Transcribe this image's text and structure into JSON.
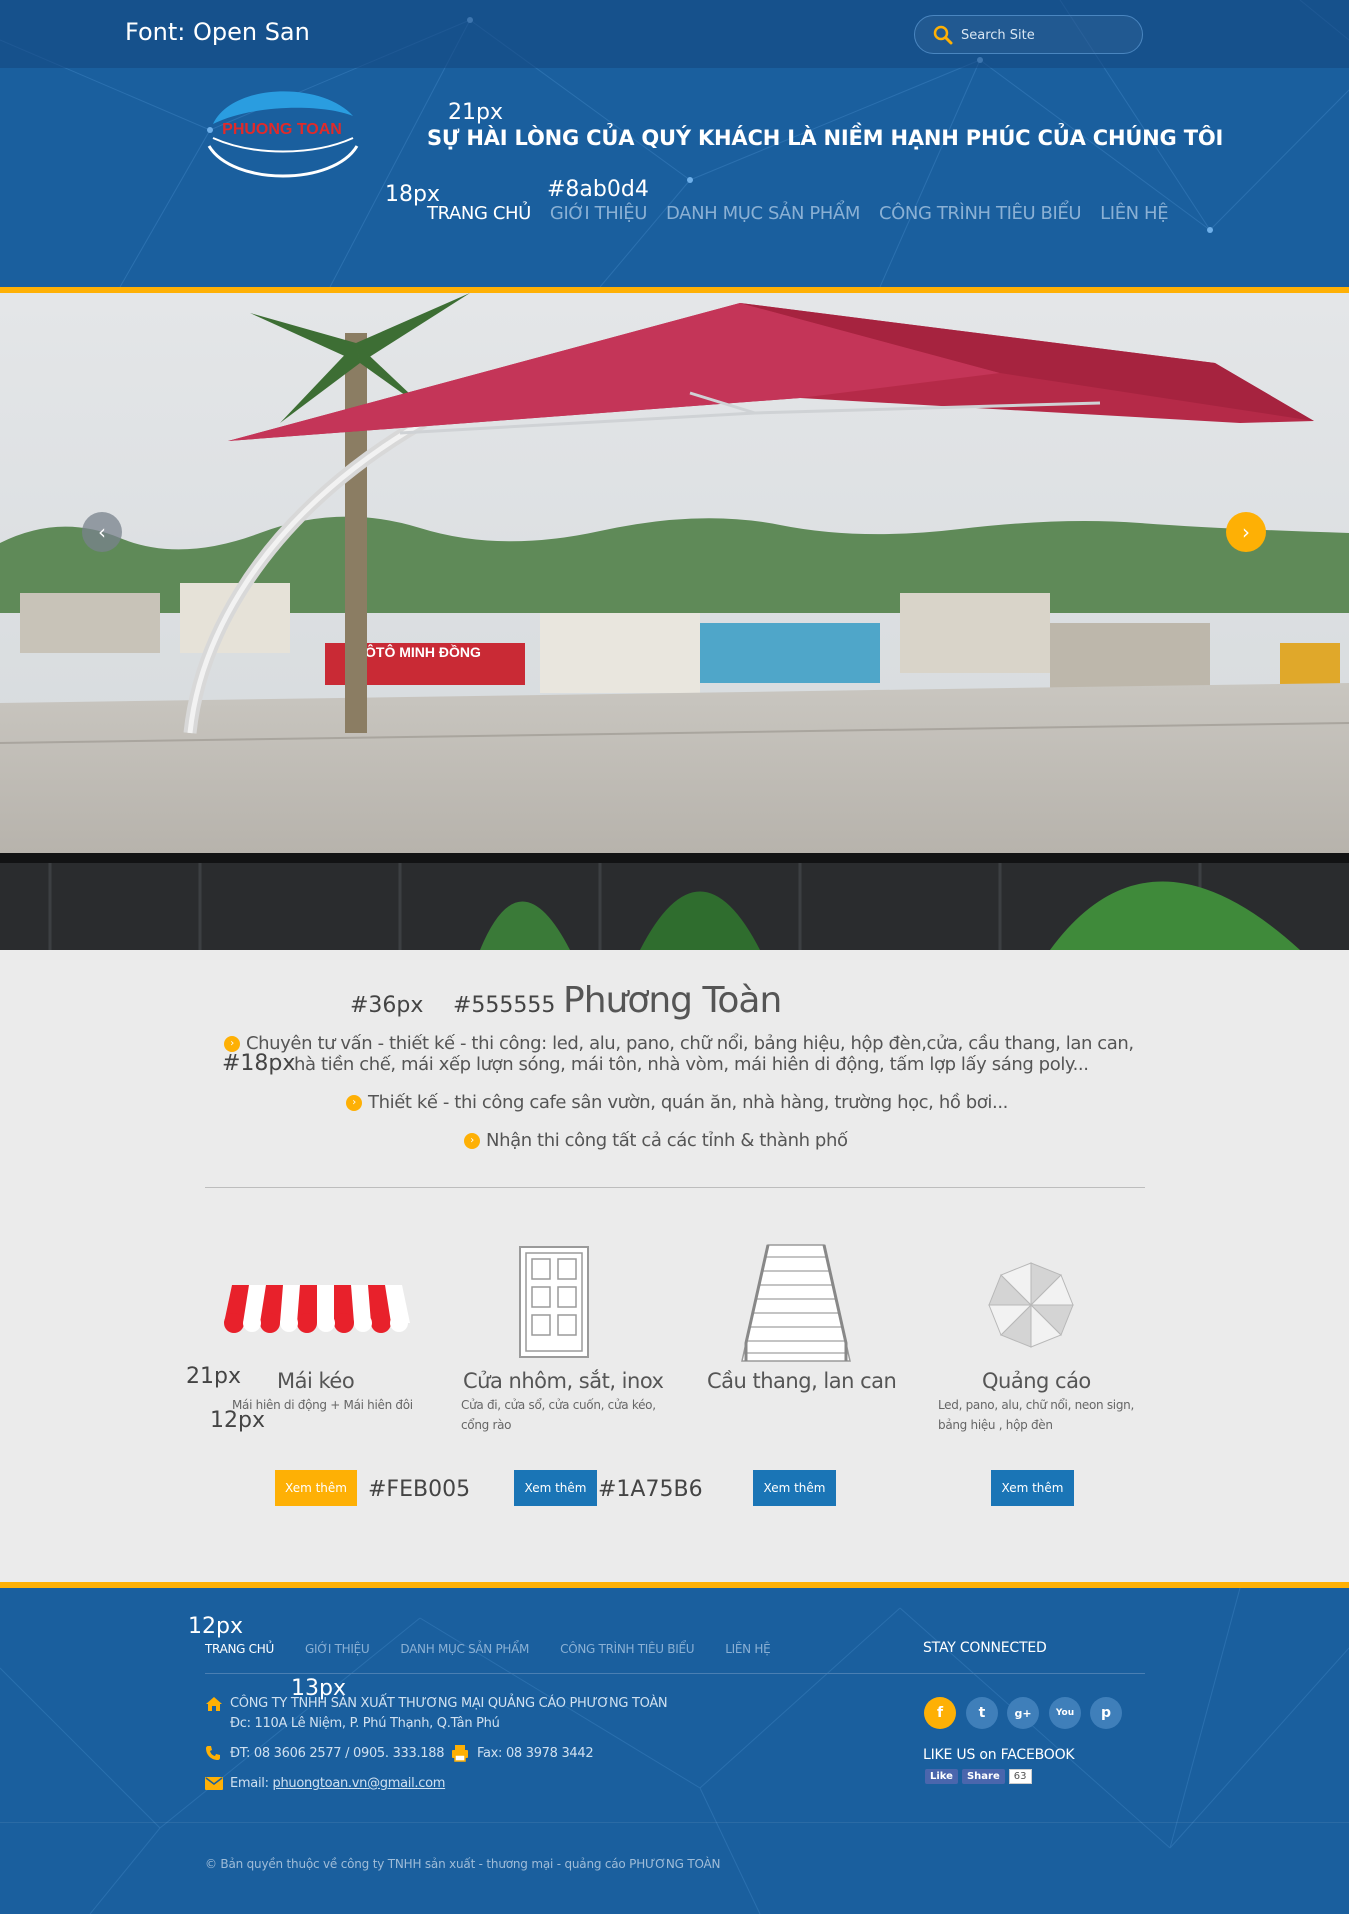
{
  "annotations": {
    "font": "Font: Open San",
    "slogan_size": "21px",
    "nav_size": "18px",
    "nav_color": "#8ab0d4",
    "intro_title_size": "#36px",
    "intro_title_color": "#555555",
    "intro_text_size": "#18px",
    "service_title_size": "21px",
    "service_desc_size": "12px",
    "btn_orange_color": "#FEB005",
    "btn_blue_color": "#1A75B6",
    "footer_nav_size": "12px",
    "footer_info_size": "13px"
  },
  "search": {
    "placeholder": "Search Site",
    "icon": "search-icon"
  },
  "logo": {
    "text": "PHUONG TOAN"
  },
  "slogan": "SỰ HÀI LÒNG CỦA QUÝ KHÁCH LÀ NIỀM HẠNH PHÚC CỦA CHÚNG TÔI",
  "nav": [
    {
      "label": "TRANG CHỦ",
      "active": true
    },
    {
      "label": "GIỚI THIỆU"
    },
    {
      "label": "DANH MỤC SẢN PHẨM"
    },
    {
      "label": "CÔNG TRÌNH TIÊU BIỂU"
    },
    {
      "label": "LIÊN HỆ"
    }
  ],
  "slider": {
    "sign_text": "ÔTÔ MINH ĐỒNG",
    "prev": "‹",
    "next": "›"
  },
  "intro": {
    "title": "Phương Toàn",
    "bullets": [
      "Chuyên tư vấn - thiết kế - thi công: led, alu, pano, chữ nổi, bảng hiệu, hộp đèn,cửa, cầu thang, lan can,",
      "hà tiền chế, mái xếp lượn sóng, mái tôn, nhà vòm, mái hiên di động, tấm lợp lấy sáng poly...",
      "Thiết kế - thi công cafe sân vườn, quán ăn, nhà hàng, trường học, hồ bơi...",
      "Nhận thi công tất cả các tỉnh & thành phố"
    ]
  },
  "services": [
    {
      "title": "Mái kéo",
      "desc": "Mái hiên di động + Mái hiên đôi",
      "button": "Xem thêm",
      "icon": "awning-icon"
    },
    {
      "title": "Cửa nhôm, sắt, inox",
      "desc1": "Cửa đi, cửa sổ, cửa cuốn, cửa kéo,",
      "desc2": "cổng rào",
      "button": "Xem thêm",
      "icon": "door-icon"
    },
    {
      "title": "Cầu thang, lan can",
      "button": "Xem thêm",
      "icon": "stairs-icon"
    },
    {
      "title": "Quảng cáo",
      "desc1": "Led, pano, alu, chữ nổi, neon sign,",
      "desc2": "bảng hiệu , hộp đèn",
      "button": "Xem thêm",
      "icon": "umbrella-icon"
    }
  ],
  "footer": {
    "nav": [
      "TRANG CHỦ",
      "GIỚI THIỆU",
      "DANH MỤC SẢN PHẨM",
      "CÔNG TRÌNH TIÊU BIỂU",
      "LIÊN HỆ"
    ],
    "company": "CÔNG TY TNHH SẢN XUẤT THƯƠNG MẠI QUẢNG CÁO PHƯƠNG TOÀN",
    "address": "Đc: 110A Lê Niệm, P. Phú Thạnh, Q.Tân Phú",
    "phone": "ĐT: 08 3606 2577  /  0905. 333.188",
    "fax": "Fax: 08 3978 3442",
    "email_label": "Email:",
    "email": "phuongtoan.vn@gmail.com",
    "stay_connected": "STAY CONNECTED",
    "social": [
      "f",
      "t",
      "g+",
      "You",
      "p"
    ],
    "like_us": "LIKE US on FACEBOOK",
    "fb_like": "Like",
    "fb_share": "Share",
    "fb_count": "63",
    "copyright": "© Bản quyền thuộc về công ty TNHH sản xuất - thương mại - quảng cáo PHƯƠNG TOÀN"
  }
}
